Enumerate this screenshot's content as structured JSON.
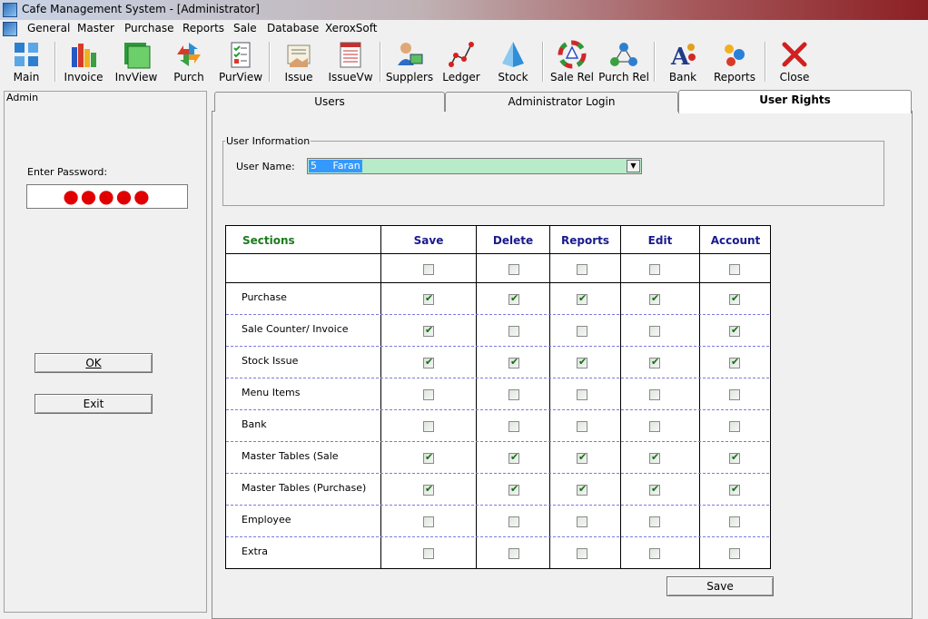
{
  "window": {
    "title": "Cafe Management System - [Administrator]"
  },
  "menu": [
    "General",
    "Master",
    "Purchase",
    "Reports",
    "Sale",
    "Database",
    "XeroxSoft"
  ],
  "toolbar": [
    {
      "label": "Main",
      "icon": "main-grid-icon"
    },
    {
      "label": "Invoice",
      "icon": "invoice-icon"
    },
    {
      "label": "InvView",
      "icon": "invoice-view-icon"
    },
    {
      "label": "Purch",
      "icon": "purchase-icon"
    },
    {
      "label": "PurView",
      "icon": "purchase-view-icon"
    },
    {
      "label": "Issue",
      "icon": "issue-icon"
    },
    {
      "label": "IssueVw",
      "icon": "issue-view-icon"
    },
    {
      "label": "Supplers",
      "icon": "suppliers-icon"
    },
    {
      "label": "Ledger",
      "icon": "ledger-icon"
    },
    {
      "label": "Stock",
      "icon": "stock-icon"
    },
    {
      "label": "Sale Rel",
      "icon": "sale-report-icon"
    },
    {
      "label": "Purch Rel",
      "icon": "purchase-report-icon"
    },
    {
      "label": "Bank",
      "icon": "bank-icon"
    },
    {
      "label": "Reports",
      "icon": "reports-icon"
    },
    {
      "label": "Close",
      "icon": "close-icon"
    }
  ],
  "admin_panel": {
    "legend": "Admin",
    "password_label": "Enter Password:",
    "password_mask": "●●●●●",
    "ok_label": "OK",
    "exit_label": "Exit"
  },
  "tabs": [
    "Users",
    "Administrator Login",
    "User Rights"
  ],
  "active_tab": "User Rights",
  "user_info": {
    "legend": "User Information",
    "username_label": "User Name:",
    "username_value": "5     Faran"
  },
  "rights": {
    "columns": [
      "Sections",
      "Save",
      "Delete",
      "Reports",
      "Edit",
      "Account"
    ],
    "header_checks": [
      false,
      false,
      false,
      false,
      false
    ],
    "rows": [
      {
        "section": "Purchase",
        "checks": [
          true,
          true,
          true,
          true,
          true
        ]
      },
      {
        "section": "Sale Counter/ Invoice",
        "checks": [
          true,
          false,
          false,
          false,
          true
        ]
      },
      {
        "section": "Stock Issue",
        "checks": [
          true,
          true,
          true,
          true,
          true
        ]
      },
      {
        "section": "Menu Items",
        "checks": [
          false,
          false,
          false,
          false,
          false
        ]
      },
      {
        "section": "Bank",
        "checks": [
          false,
          false,
          false,
          false,
          false
        ]
      },
      {
        "section": "Master Tables (Sale",
        "checks": [
          true,
          true,
          true,
          true,
          true
        ]
      },
      {
        "section": "Master Tables (Purchase)",
        "checks": [
          true,
          true,
          true,
          true,
          true
        ]
      },
      {
        "section": "Employee",
        "checks": [
          false,
          false,
          false,
          false,
          false
        ]
      },
      {
        "section": "Extra",
        "checks": [
          false,
          false,
          false,
          false,
          false
        ]
      }
    ]
  },
  "save_label": "Save"
}
